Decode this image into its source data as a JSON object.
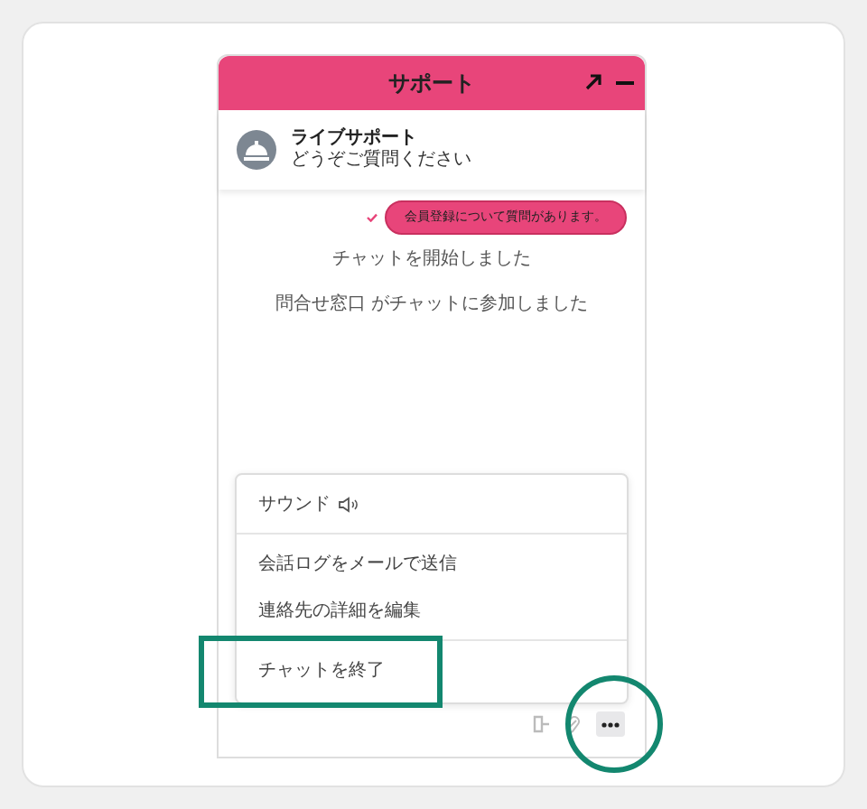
{
  "window": {
    "title": "サポート"
  },
  "agent": {
    "name": "ライブサポート",
    "status": "どうぞご質問ください"
  },
  "messages": [
    {
      "kind": "user",
      "text": "会員登録について質問があります。",
      "delivered": true
    },
    {
      "kind": "system",
      "text": "チャットを開始しました"
    },
    {
      "kind": "system",
      "text": "問合せ窓口 がチャットに参加しました"
    }
  ],
  "menu": [
    [
      {
        "kind": "sound",
        "label": "サウンド"
      }
    ],
    [
      {
        "kind": "plain",
        "label": "会話ログをメールで送信"
      },
      {
        "kind": "plain",
        "label": "連絡先の詳細を編集"
      }
    ],
    [
      {
        "kind": "plain",
        "label": "チャットを終了"
      }
    ]
  ]
}
